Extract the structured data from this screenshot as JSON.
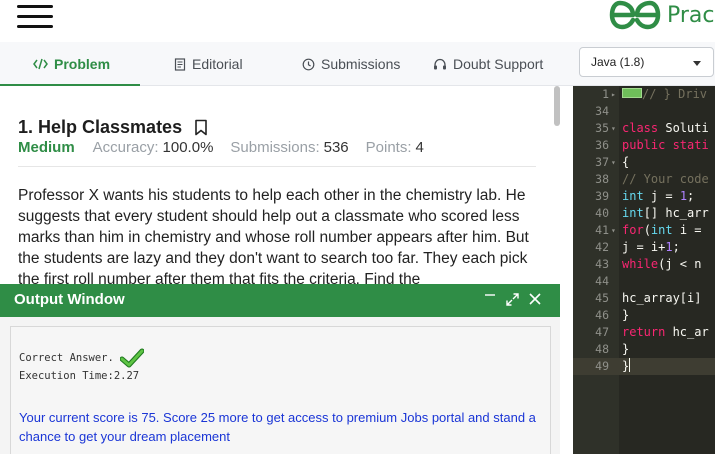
{
  "header": {
    "brand_text": "Prac",
    "brand_color": "#2f8d46",
    "menu_icon": "hamburger-icon",
    "logo_icon": "gfg-logo-icon"
  },
  "tabs": [
    {
      "label": "Problem",
      "icon": "code-icon",
      "active": true
    },
    {
      "label": "Editorial",
      "icon": "document-icon",
      "active": false
    },
    {
      "label": "Submissions",
      "icon": "clock-icon",
      "active": false
    },
    {
      "label": "Doubt Support",
      "icon": "headset-icon",
      "active": false
    }
  ],
  "language_select": {
    "value": "Java (1.8)"
  },
  "problem": {
    "title": "1. Help Classmates",
    "difficulty": "Medium",
    "accuracy_label": "Accuracy:",
    "accuracy_value": "100.0%",
    "submissions_label": "Submissions:",
    "submissions_value": "536",
    "points_label": "Points:",
    "points_value": "4",
    "statement": "Professor X wants his students to help each other in the chemistry lab. He suggests that every student should help out a classmate who scored less marks than him in chemistry and whose roll number appears after him. But the students are lazy and they don't want to search too far. They each pick the first roll number after them that fits the criteria. Find the"
  },
  "output": {
    "title": "Output Window",
    "minimize_icon": "minimize-icon",
    "expand_icon": "expand-icon",
    "close_icon": "close-icon",
    "correct_text": "Correct Answer.",
    "execution_text": "Execution Time:2.27",
    "score_message": "Your current score is 75. Score 25 more to get access to premium Jobs portal and stand a chance to get your dream placement"
  },
  "editor": {
    "lines": [
      {
        "num": "1",
        "fold": "▸",
        "segments": [
          {
            "cls": "c",
            "text": "// } Driv"
          }
        ],
        "marker": true
      },
      {
        "num": "34",
        "fold": "",
        "segments": []
      },
      {
        "num": "35",
        "fold": "▾",
        "segments": [
          {
            "cls": "k",
            "text": "class "
          },
          {
            "cls": "",
            "text": "Soluti"
          }
        ]
      },
      {
        "num": "36",
        "fold": "",
        "segments": [
          {
            "cls": "k",
            "text": "public "
          },
          {
            "cls": "k",
            "text": "stati"
          }
        ]
      },
      {
        "num": "37",
        "fold": "▾",
        "segments": [
          {
            "cls": "",
            "text": "{"
          }
        ]
      },
      {
        "num": "38",
        "fold": "",
        "segments": [
          {
            "cls": "c",
            "text": "// Your code"
          }
        ]
      },
      {
        "num": "39",
        "fold": "",
        "segments": [
          {
            "cls": "t",
            "text": "int "
          },
          {
            "cls": "",
            "text": "j = "
          },
          {
            "cls": "n",
            "text": "1"
          },
          {
            "cls": "",
            "text": ";"
          }
        ]
      },
      {
        "num": "40",
        "fold": "",
        "segments": [
          {
            "cls": "t",
            "text": "int"
          },
          {
            "cls": "",
            "text": "[] hc_arr"
          }
        ]
      },
      {
        "num": "41",
        "fold": "▾",
        "segments": [
          {
            "cls": "k",
            "text": "for"
          },
          {
            "cls": "",
            "text": "("
          },
          {
            "cls": "t",
            "text": "int "
          },
          {
            "cls": "",
            "text": "i = "
          }
        ]
      },
      {
        "num": "42",
        "fold": "",
        "segments": [
          {
            "cls": "",
            "text": "j = i+"
          },
          {
            "cls": "n",
            "text": "1"
          },
          {
            "cls": "",
            "text": ";"
          }
        ]
      },
      {
        "num": "43",
        "fold": "",
        "segments": [
          {
            "cls": "k",
            "text": "while"
          },
          {
            "cls": "",
            "text": "(j < n"
          }
        ]
      },
      {
        "num": "44",
        "fold": "",
        "segments": []
      },
      {
        "num": "45",
        "fold": "",
        "segments": [
          {
            "cls": "",
            "text": "hc_array[i]"
          }
        ]
      },
      {
        "num": "46",
        "fold": "",
        "segments": [
          {
            "cls": "",
            "text": "}"
          }
        ]
      },
      {
        "num": "47",
        "fold": "",
        "segments": [
          {
            "cls": "k",
            "text": "return "
          },
          {
            "cls": "",
            "text": "hc_ar"
          }
        ]
      },
      {
        "num": "48",
        "fold": "",
        "segments": [
          {
            "cls": "",
            "text": "}"
          }
        ]
      },
      {
        "num": "49",
        "fold": "",
        "segments": [
          {
            "cls": "",
            "text": "}"
          }
        ],
        "active": true
      }
    ]
  }
}
